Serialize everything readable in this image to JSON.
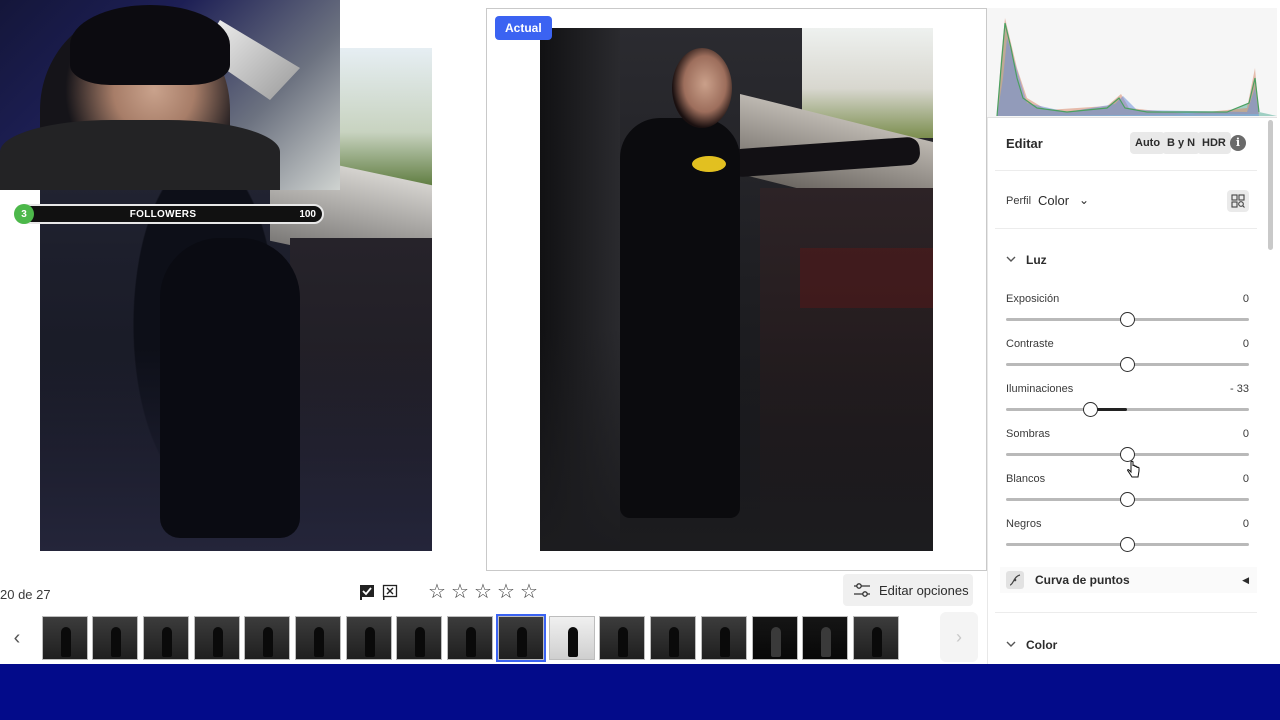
{
  "webcam_overlay": {
    "followers_count": "3",
    "followers_label": "FOLLOWERS",
    "followers_goal": "100"
  },
  "viewer": {
    "compare_badge": "Actual",
    "photo_counter": "20 de 27",
    "rating_stars": 0,
    "edit_options_label": "Editar opciones"
  },
  "filmstrip": {
    "thumbnail_count": 17,
    "selected_index": 9
  },
  "panel": {
    "title": "Editar",
    "modes": [
      "Auto",
      "B y N",
      "HDR"
    ],
    "profile_label": "Perfil",
    "profile_value": "Color",
    "sections": {
      "light": "Luz",
      "point_curve": "Curva de puntos",
      "color": "Color"
    },
    "sliders": [
      {
        "label": "Exposición",
        "value": "0"
      },
      {
        "label": "Contraste",
        "value": "0"
      },
      {
        "label": "Iluminaciones",
        "value": "- 33"
      },
      {
        "label": "Sombras",
        "value": "0"
      },
      {
        "label": "Blancos",
        "value": "0"
      },
      {
        "label": "Negros",
        "value": "0"
      }
    ]
  },
  "colors": {
    "accent_blue": "#3b63f2",
    "bottom_bar": "#030b8a",
    "followers_green": "#4cb84a"
  }
}
